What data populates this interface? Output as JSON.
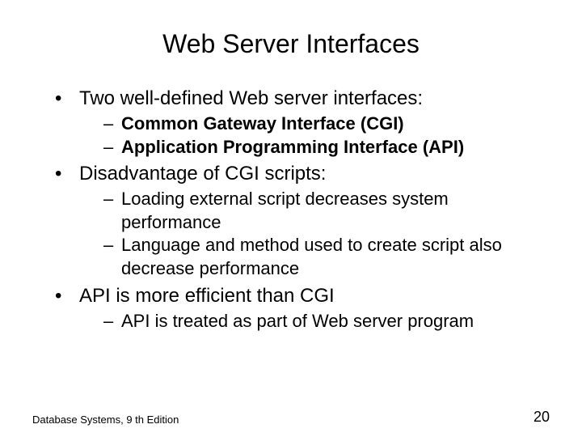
{
  "title": "Web Server Interfaces",
  "bullets": [
    {
      "text": "Two well-defined Web server interfaces:",
      "sub": [
        {
          "text": "Common Gateway Interface (CGI)",
          "bold": true
        },
        {
          "text": "Application Programming Interface (API)",
          "bold": true
        }
      ]
    },
    {
      "text": "Disadvantage of CGI scripts:",
      "sub": [
        {
          "text": "Loading external script decreases system performance",
          "bold": false
        },
        {
          "text": "Language and method used to create script also decrease performance",
          "bold": false
        }
      ]
    },
    {
      "text": "API is more efficient than CGI",
      "sub": [
        {
          "text": "API is treated as part of Web server program",
          "bold": false
        }
      ]
    }
  ],
  "footer_left": "Database Systems, 9 th Edition",
  "footer_right": "20"
}
